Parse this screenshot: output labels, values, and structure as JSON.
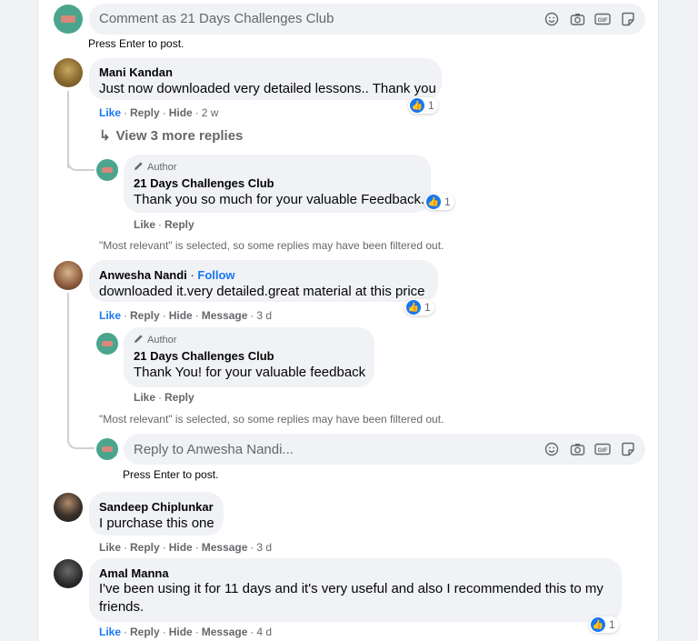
{
  "top_input": {
    "placeholder": "Comment as 21 Days Challenges Club",
    "hint": "Press Enter to post."
  },
  "comments": [
    {
      "name": "Mani Kandan",
      "text": "Just now downloaded very detailed lessons.. Thank you",
      "actions": [
        "Like",
        "Reply",
        "Hide"
      ],
      "time": "2 w",
      "reactions": "1",
      "view_more": "View 3 more replies",
      "reply": {
        "badge": "Author",
        "name": "21 Days Challenges Club",
        "text": "Thank you so much for your valuable Feedback.",
        "reactions": "1",
        "actions": [
          "Like",
          "Reply"
        ]
      },
      "filter_note": "\"Most relevant\" is selected, so some replies may have been filtered out."
    },
    {
      "name": "Anwesha Nandi",
      "follow": "Follow",
      "text": "downloaded it.very detailed.great material at this price",
      "actions": [
        "Like",
        "Reply",
        "Hide",
        "Message"
      ],
      "time": "3 d",
      "reactions": "1",
      "reply": {
        "badge": "Author",
        "name": "21 Days Challenges Club",
        "text": "Thank You! for your valuable feedback",
        "actions": [
          "Like",
          "Reply"
        ]
      },
      "filter_note": "\"Most relevant\" is selected, so some replies may have been filtered out.",
      "reply_input": {
        "placeholder": "Reply to Anwesha Nandi...",
        "hint": "Press Enter to post."
      }
    },
    {
      "name": "Sandeep Chiplunkar",
      "text": "I purchase this one",
      "actions": [
        "Like",
        "Reply",
        "Hide",
        "Message"
      ],
      "time": "3 d"
    },
    {
      "name": "Amal Manna",
      "text": "I've been using it for 11 days and it's very useful and also I recommended this to my friends.",
      "actions": [
        "Like",
        "Reply",
        "Hide",
        "Message"
      ],
      "time": "4 d",
      "reactions": "1"
    }
  ],
  "icons": [
    "emoji-icon",
    "camera-icon",
    "gif-icon",
    "sticker-icon"
  ],
  "colors": {
    "link": "#1877f2",
    "bubble": "#f0f2f5",
    "muted": "#65676b"
  }
}
